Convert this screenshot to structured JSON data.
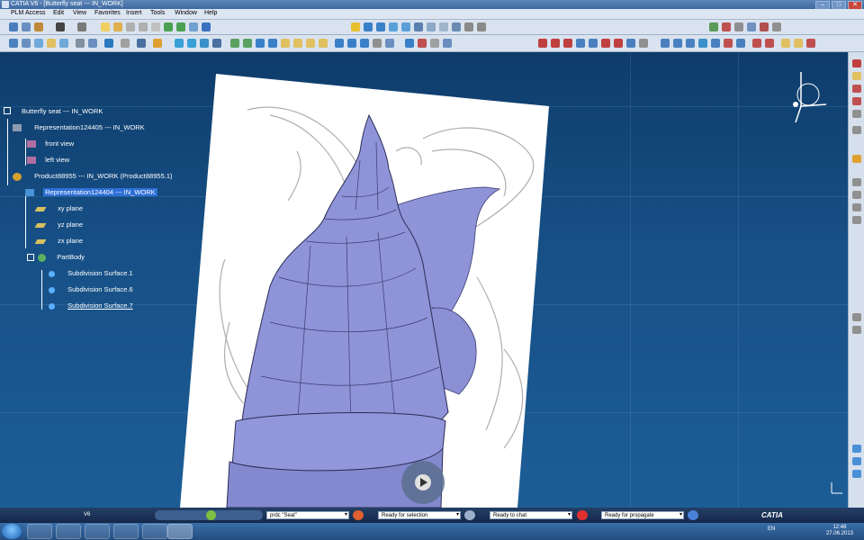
{
  "window": {
    "title": "CATIA V6 - [Butterfly seat --- IN_WORK]"
  },
  "menu": {
    "plm_access": "PLM Access",
    "edit": "Edit",
    "view": "View",
    "favorites": "Favorites",
    "insert": "Insert",
    "tools": "Tools",
    "window": "Window",
    "help": "Help"
  },
  "tree": {
    "root": "Butterfly seat --- IN_WORK",
    "representation_1": "Representation124405 --- IN_WORK",
    "front_view": "front view",
    "left_view": "left view",
    "product": "Product88955 --- IN_WORK (Product88955.1)",
    "representation_2": "Representation124404 --- IN_WORK",
    "xy_plane": "xy plane",
    "yz_plane": "yz plane",
    "zx_plane": "zx plane",
    "partbody": "PartBody",
    "surface_1": "Subdivision Surface.1",
    "surface_6": "Subdivision Surface.6",
    "surface_7": "Subdivision Surface.7"
  },
  "status": {
    "v6_label": "V6",
    "field_1": "prdc \"Seat\"",
    "field_2": "Ready for selection",
    "field_3": "Ready to chat",
    "field_4": "Ready for propagate",
    "brand": "CATIA"
  },
  "taskbar": {
    "lang": "EN",
    "time": "12:48",
    "date": "27.06.2013"
  },
  "colors": {
    "viewport_bg": "#164f85",
    "model": "#8f93d8",
    "selection": "#2d6fd6"
  }
}
